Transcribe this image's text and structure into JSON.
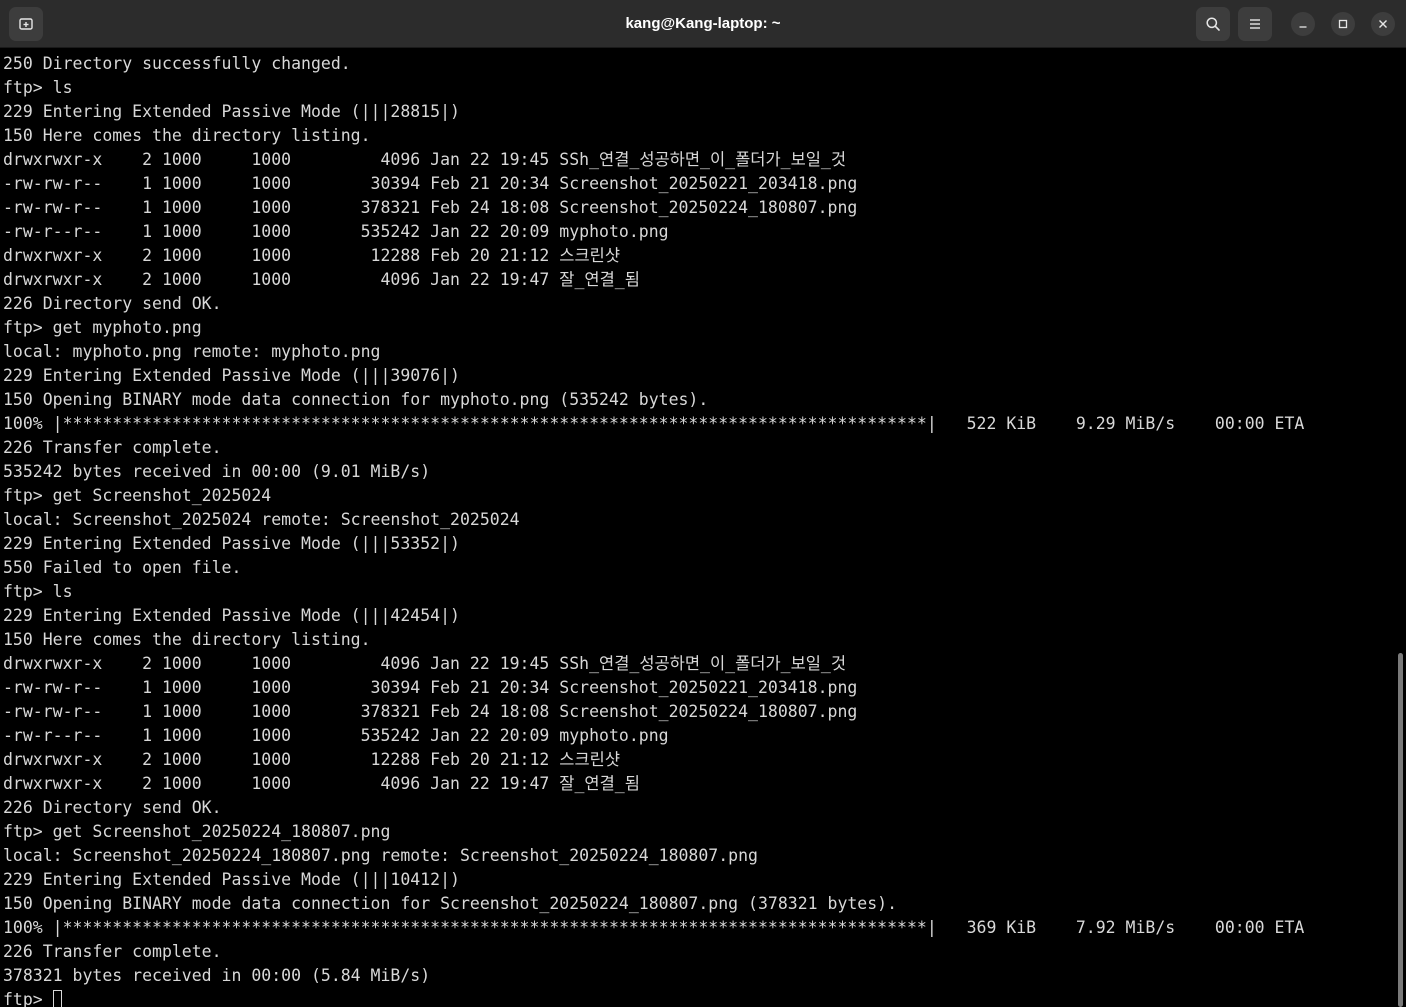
{
  "window": {
    "title": "kang@Kang-laptop: ~"
  },
  "toolbar": {
    "new_tab_icon": "new-tab-icon",
    "search_icon": "search-icon",
    "menu_icon": "hamburger-menu-icon",
    "minimize_icon": "minimize-icon",
    "maximize_icon": "maximize-icon",
    "close_icon": "close-icon"
  },
  "terminal": {
    "lines": [
      "250 Directory successfully changed.",
      "ftp> ls",
      "229 Entering Extended Passive Mode (|||28815|)",
      "150 Here comes the directory listing.",
      "drwxrwxr-x    2 1000     1000         4096 Jan 22 19:45 SSh_연결_성공하면_이_폴더가_보일_것",
      "-rw-rw-r--    1 1000     1000        30394 Feb 21 20:34 Screenshot_20250221_203418.png",
      "-rw-rw-r--    1 1000     1000       378321 Feb 24 18:08 Screenshot_20250224_180807.png",
      "-rw-r--r--    1 1000     1000       535242 Jan 22 20:09 myphoto.png",
      "drwxrwxr-x    2 1000     1000        12288 Feb 20 21:12 스크린샷",
      "drwxrwxr-x    2 1000     1000         4096 Jan 22 19:47 잘_연결_됨",
      "226 Directory send OK.",
      "ftp> get myphoto.png",
      "local: myphoto.png remote: myphoto.png",
      "229 Entering Extended Passive Mode (|||39076|)",
      "150 Opening BINARY mode data connection for myphoto.png (535242 bytes).",
      "100% |***************************************************************************************|   522 KiB    9.29 MiB/s    00:00 ETA",
      "226 Transfer complete.",
      "535242 bytes received in 00:00 (9.01 MiB/s)",
      "ftp> get Screenshot_2025024",
      "local: Screenshot_2025024 remote: Screenshot_2025024",
      "229 Entering Extended Passive Mode (|||53352|)",
      "550 Failed to open file.",
      "ftp> ls",
      "229 Entering Extended Passive Mode (|||42454|)",
      "150 Here comes the directory listing.",
      "drwxrwxr-x    2 1000     1000         4096 Jan 22 19:45 SSh_연결_성공하면_이_폴더가_보일_것",
      "-rw-rw-r--    1 1000     1000        30394 Feb 21 20:34 Screenshot_20250221_203418.png",
      "-rw-rw-r--    1 1000     1000       378321 Feb 24 18:08 Screenshot_20250224_180807.png",
      "-rw-r--r--    1 1000     1000       535242 Jan 22 20:09 myphoto.png",
      "drwxrwxr-x    2 1000     1000        12288 Feb 20 21:12 스크린샷",
      "drwxrwxr-x    2 1000     1000         4096 Jan 22 19:47 잘_연결_됨",
      "226 Directory send OK.",
      "ftp> get Screenshot_20250224_180807.png",
      "local: Screenshot_20250224_180807.png remote: Screenshot_20250224_180807.png",
      "229 Entering Extended Passive Mode (|||10412|)",
      "150 Opening BINARY mode data connection for Screenshot_20250224_180807.png (378321 bytes).",
      "100% |***************************************************************************************|   369 KiB    7.92 MiB/s    00:00 ETA",
      "226 Transfer complete.",
      "378321 bytes received in 00:00 (5.84 MiB/s)"
    ],
    "prompt": "ftp> "
  },
  "colors": {
    "background": "#000000",
    "text": "#d8d8d8",
    "titlebar": "#2c2c2c"
  }
}
